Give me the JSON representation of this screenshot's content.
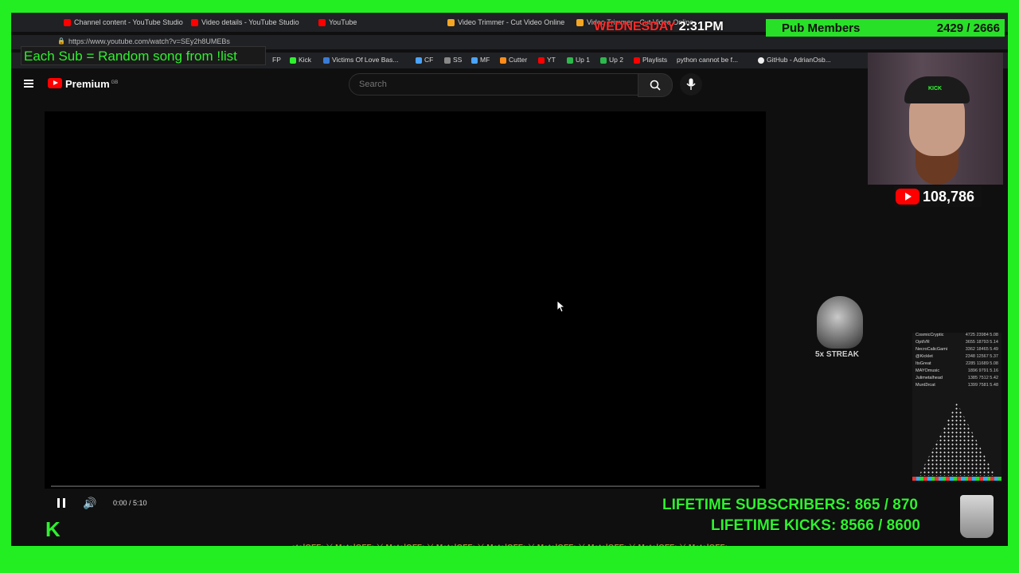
{
  "browser": {
    "tabs": [
      {
        "label": "Channel content - YouTube Studio"
      },
      {
        "label": "Video details - YouTube Studio"
      },
      {
        "label": "YouTube"
      },
      {
        "label": "Video Trimmer - Cut Video Online"
      },
      {
        "label": "Video Trimmer - Cut Video Online"
      }
    ],
    "url": "https://www.youtube.com/watch?v=SEy2h8UMEBs",
    "bookmarks": [
      "FP",
      "Kick",
      "Victims Of Love Bas...",
      "CF",
      "SS",
      "MF",
      "Cutter",
      "YT",
      "Up 1",
      "Up 2",
      "Playlists",
      "python cannot be f...",
      "GitHub - AdrianOsb..."
    ]
  },
  "overlay": {
    "sub_banner": "Each Sub = Random song from !list",
    "clock_day": "WEDNESDAY",
    "clock_time": "2:31PM",
    "pub_label": "Pub Members",
    "pub_value": "2429 / 2666",
    "yt_subs": "108,786",
    "cam_hat": "KICK",
    "streak": "5x STREAK",
    "lifetime_subscribers": "LIFETIME SUBSCRIBERS: 865 / 870",
    "lifetime_kicks": "LIFETIME KICKS: 8566 / 8600",
    "kick_logo": "K",
    "ticker": "etalOFF: ⚔ MetalOFF: ⚔ MetalOFF: ⚔ MetalOFF: ⚔ MetalOFF: ⚔ MetalOFF: ⚔ MetalOFF: ⚔ MetalOFF: ⚔ MetalOFF:",
    "leaderboard": [
      {
        "name": "CosmicCryptic",
        "stats": "4725 23984 5.08"
      },
      {
        "name": "OptiVR",
        "stats": "3655 18793 5.14"
      },
      {
        "name": "NecroCalicGami",
        "stats": "3362 18465 5.49"
      },
      {
        "name": "@Kicklet",
        "stats": "2348 12567 5.37"
      },
      {
        "name": "ItsGreat",
        "stats": "2285 11689 5.08"
      },
      {
        "name": "MAYOmusic",
        "stats": "1896 9791 5.16"
      },
      {
        "name": "Julimetalhead",
        "stats": "1385 7512 5.42"
      },
      {
        "name": "Murd3rcat",
        "stats": "1399 7581 5.48"
      }
    ]
  },
  "youtube": {
    "brand": "Premium",
    "brand_sup": "GB",
    "search_placeholder": "Search",
    "time": "0:00 / 5:10",
    "progress": 0
  }
}
